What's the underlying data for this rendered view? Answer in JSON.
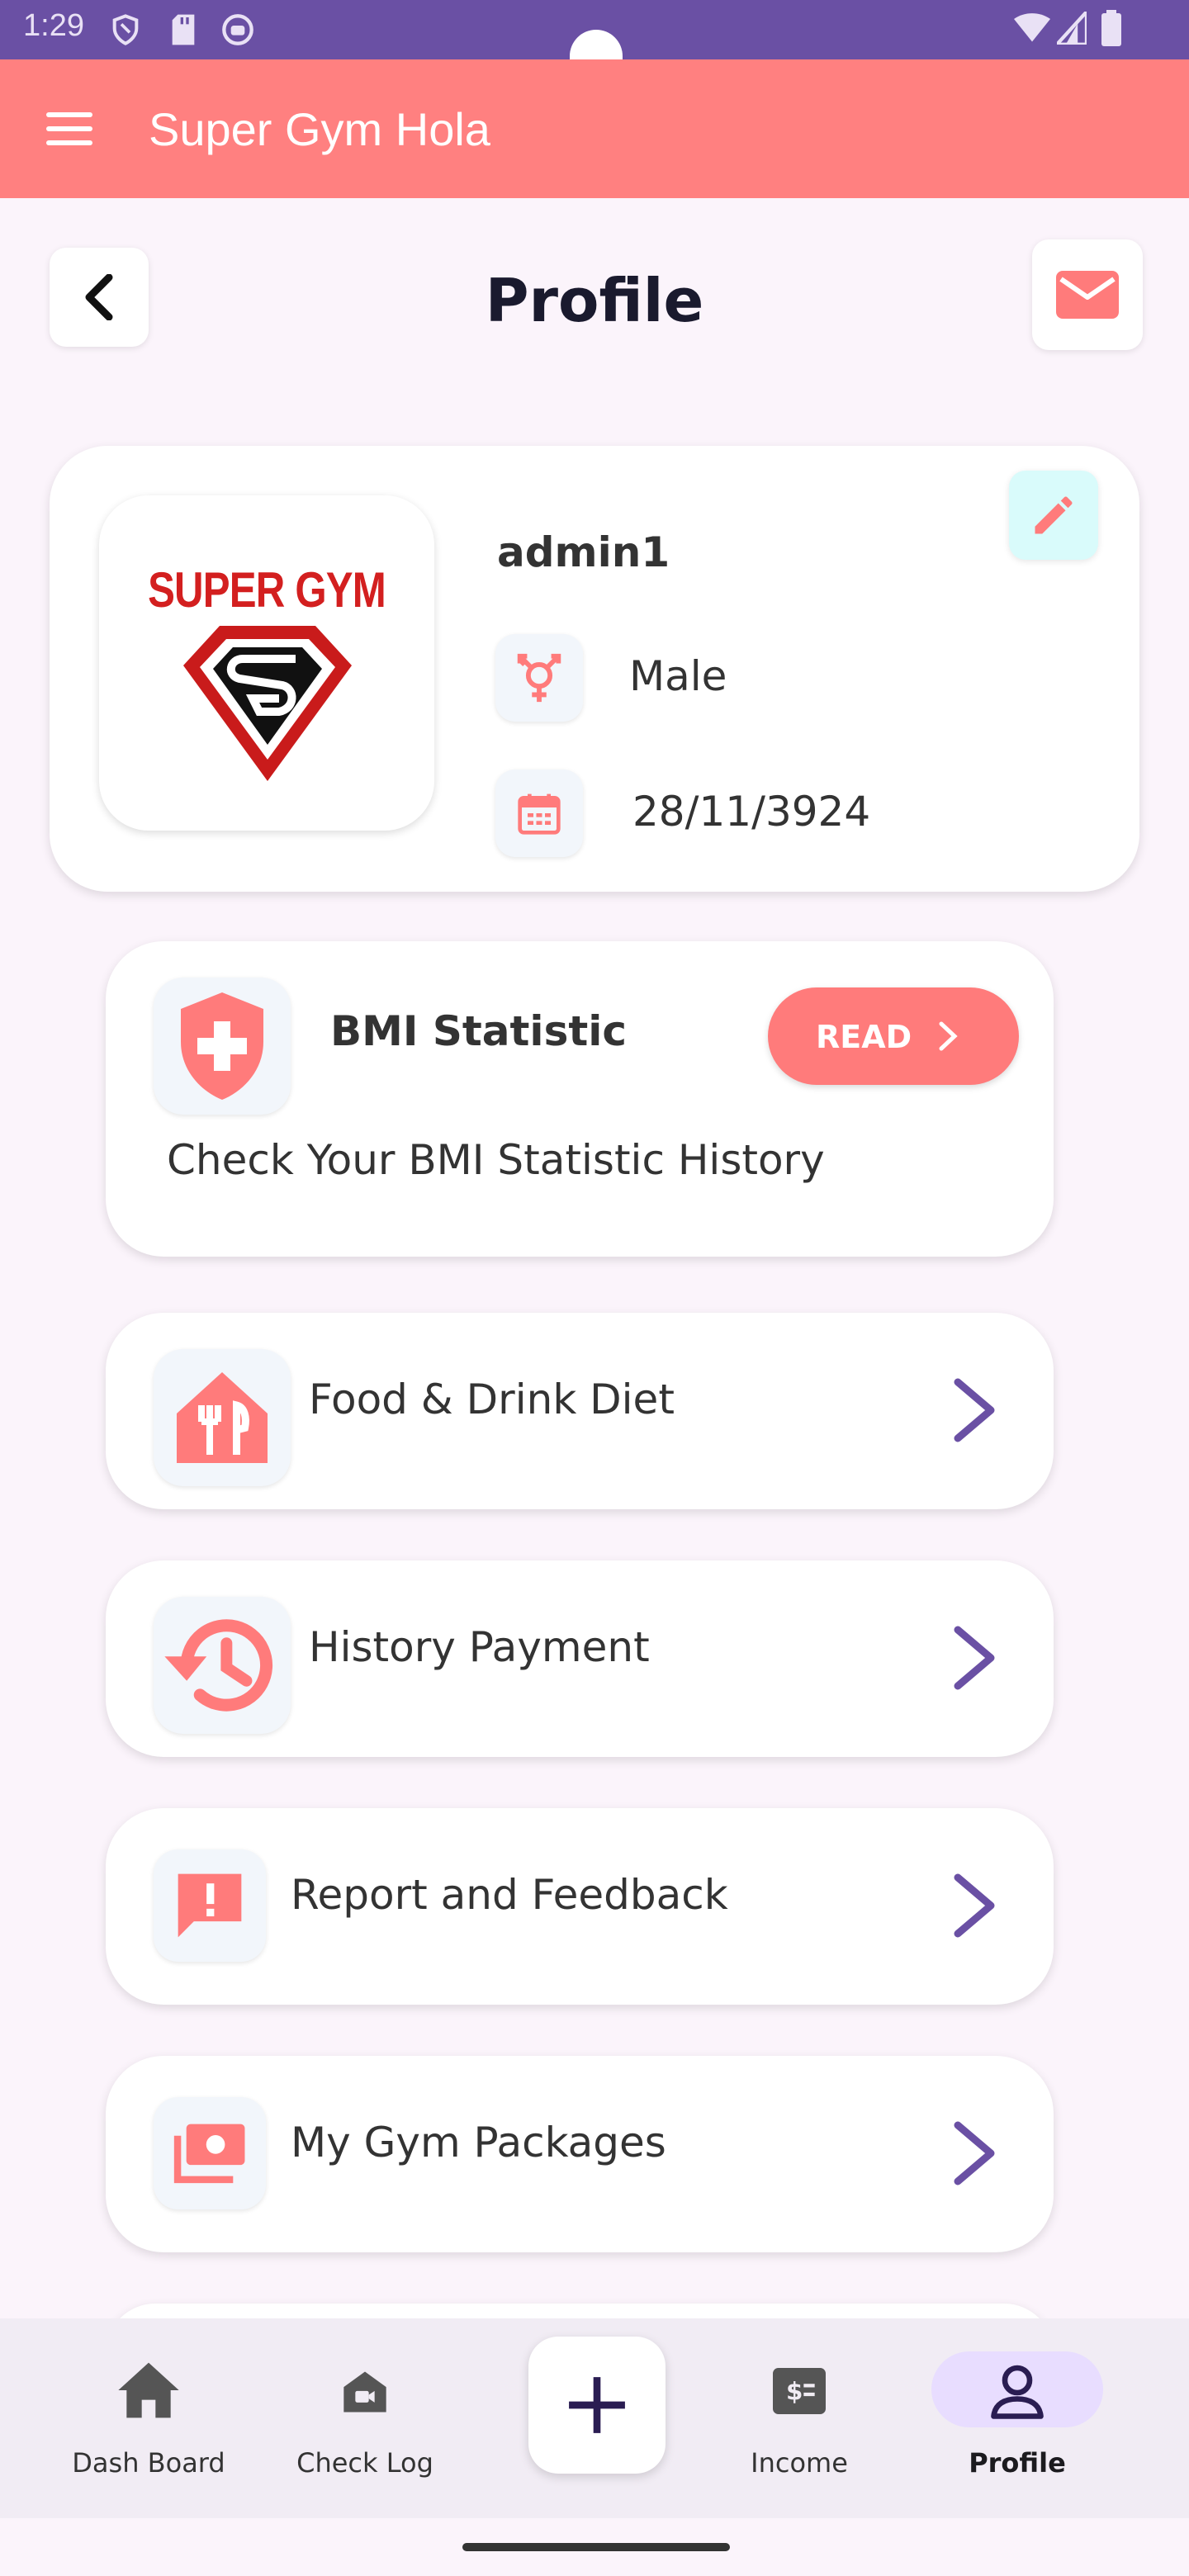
{
  "status_bar": {
    "time": "1:29"
  },
  "app_bar": {
    "title": "Super Gym Hola"
  },
  "page": {
    "title": "Profile"
  },
  "profile": {
    "logo_text": "SUPER GYM",
    "username": "admin1",
    "gender": "Male",
    "birthdate": "28/11/3924"
  },
  "bmi_card": {
    "title": "BMI Statistic",
    "button_label": "READ",
    "description": "Check Your BMI Statistic History"
  },
  "menu_items": [
    {
      "label": "Food & Drink Diet",
      "icon": "food-icon"
    },
    {
      "label": "History Payment",
      "icon": "history-icon"
    },
    {
      "label": "Report and Feedback",
      "icon": "report-icon"
    },
    {
      "label": "My Gym Packages",
      "icon": "packages-icon"
    }
  ],
  "bottom_nav": {
    "items": [
      {
        "label": "Dash Board",
        "icon": "home-icon"
      },
      {
        "label": "Check Log",
        "icon": "checklog-icon"
      },
      {
        "label": "Income",
        "icon": "income-icon"
      },
      {
        "label": "Profile",
        "icon": "profile-icon",
        "active": true
      }
    ]
  },
  "colors": {
    "accent": "#ff8080",
    "status_bar": "#6a50a4",
    "chevron": "#6a50a4",
    "background": "#fbf4fb"
  }
}
